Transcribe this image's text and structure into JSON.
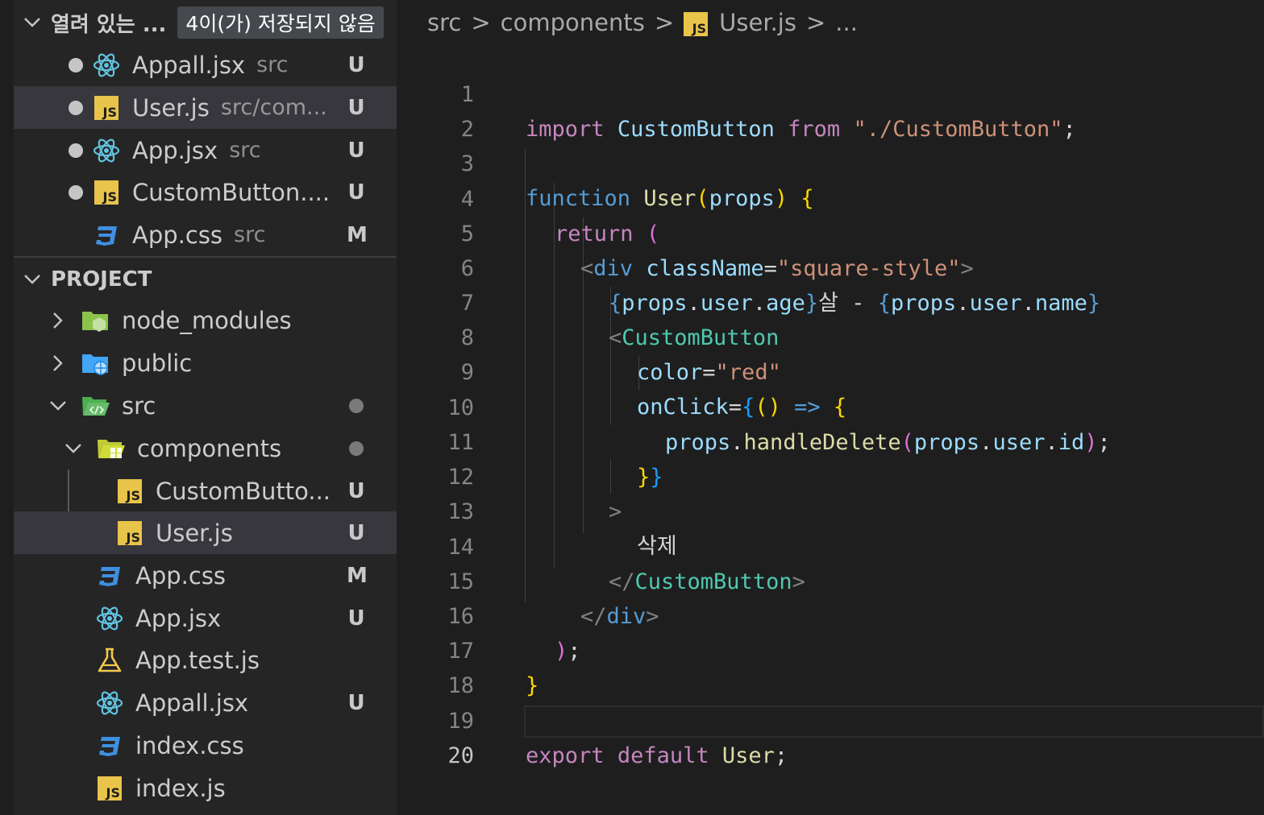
{
  "open_editors": {
    "title": "열려 있는 ...",
    "dirty_badge": "4이(가) 저장되지 않음",
    "items": [
      {
        "name": "Appall.jsx",
        "path": "src",
        "status": "U",
        "icon": "react-icon",
        "dirty": true
      },
      {
        "name": "User.js",
        "path": "src/com...",
        "status": "U",
        "icon": "js-icon",
        "dirty": true
      },
      {
        "name": "App.jsx",
        "path": "src",
        "status": "U",
        "icon": "react-icon",
        "dirty": true
      },
      {
        "name": "CustomButton....",
        "path": "",
        "status": "U",
        "icon": "js-icon",
        "dirty": true
      },
      {
        "name": "App.css",
        "path": "src",
        "status": "M",
        "icon": "css-icon",
        "dirty": false
      }
    ]
  },
  "project": {
    "title": "PROJECT",
    "tree": [
      {
        "name": "node_modules",
        "kind": "folder-node"
      },
      {
        "name": "public",
        "kind": "folder-public"
      },
      {
        "name": "src",
        "kind": "folder-src"
      },
      {
        "name": "components",
        "kind": "folder-components"
      },
      {
        "name": "CustomButto...",
        "status": "U"
      },
      {
        "name": "User.js",
        "status": "U"
      },
      {
        "name": "App.css",
        "status": "M"
      },
      {
        "name": "App.jsx",
        "status": "U"
      },
      {
        "name": "App.test.js",
        "status": ""
      },
      {
        "name": "Appall.jsx",
        "status": "U"
      },
      {
        "name": "index.css",
        "status": ""
      },
      {
        "name": "index.js",
        "status": ""
      }
    ]
  },
  "breadcrumb": {
    "parts": [
      "src",
      "components",
      "User.js",
      "..."
    ],
    "separator": ">"
  },
  "editor": {
    "line_numbers": [
      "1",
      "2",
      "3",
      "4",
      "5",
      "6",
      "7",
      "8",
      "9",
      "10",
      "11",
      "12",
      "13",
      "14",
      "15",
      "16",
      "17",
      "18",
      "19",
      "20"
    ],
    "active_line": "20",
    "tokens": {
      "l1": [
        "import",
        " ",
        "CustomButton",
        " ",
        "from",
        " ",
        "\"./CustomButton\"",
        ";"
      ],
      "l3": [
        "function",
        " ",
        "User",
        "(",
        "props",
        ")",
        " ",
        "{"
      ],
      "l4": [
        "return",
        " ",
        "("
      ],
      "l5": [
        "<",
        "div",
        " ",
        "className",
        "=",
        "\"square-style\"",
        ">"
      ],
      "l6": [
        "{",
        "props",
        ".",
        "user",
        ".",
        "age",
        "}",
        "살 - ",
        "{",
        "props",
        ".",
        "user",
        ".",
        "name",
        "}"
      ],
      "l7": [
        "<",
        "CustomButton"
      ],
      "l8": [
        "color",
        "=",
        "\"red\""
      ],
      "l9": [
        "onClick",
        "=",
        "{",
        "()",
        " ",
        "=>",
        " ",
        "{"
      ],
      "l10": [
        "props",
        ".",
        "handleDelete",
        "(",
        "props",
        ".",
        "user",
        ".",
        "id",
        ")",
        ";"
      ],
      "l11": [
        "}",
        "}"
      ],
      "l12": [
        ">"
      ],
      "l13": [
        "삭제"
      ],
      "l14": [
        "</",
        "CustomButton",
        ">"
      ],
      "l15": [
        "</",
        "div",
        ">"
      ],
      "l16": [
        ")",
        ";"
      ],
      "l17": [
        "}"
      ],
      "l19": [
        "export",
        " ",
        "default",
        " ",
        "User",
        ";"
      ]
    }
  },
  "colors": {
    "keyword": "#c586c0",
    "storage": "#569cd6",
    "function": "#dcdcaa",
    "variable": "#9cdcfe",
    "type": "#4ec9b0",
    "string": "#ce9178",
    "bracket1": "#ffd700",
    "bracket2": "#da70d6",
    "bracket3": "#179fff"
  }
}
